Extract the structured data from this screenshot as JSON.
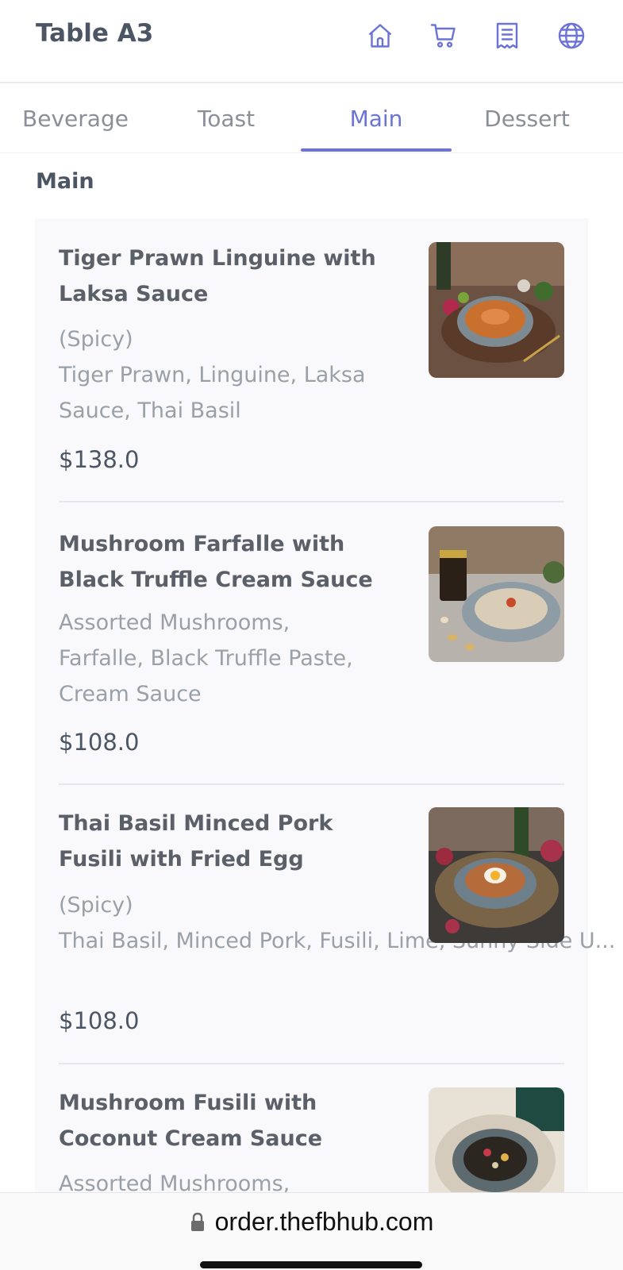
{
  "header": {
    "title": "Table A3",
    "icons": [
      "home-icon",
      "cart-icon",
      "receipt-icon",
      "globe-icon"
    ],
    "accent_color": "#6b73d8"
  },
  "tabs": [
    {
      "label": "Beverage",
      "active": false
    },
    {
      "label": "Toast",
      "active": false
    },
    {
      "label": "Main",
      "active": true
    },
    {
      "label": "Dessert",
      "active": false
    }
  ],
  "section": {
    "title": "Main"
  },
  "items": [
    {
      "name": "Tiger Prawn Linguine with Laksa Sauce",
      "note": "(Spicy)",
      "ingredients": "Tiger Prawn, Linguine, Laksa Sauce, Thai Basil",
      "price": "$138.0"
    },
    {
      "name": "Mushroom Farfalle with Black Truffle Cream Sauce",
      "note": "",
      "ingredients": "Assorted Mushrooms, Farfalle, Black Truffle Paste, Cream Sauce",
      "price": "$108.0"
    },
    {
      "name": "Thai Basil Minced Pork Fusili with Fried Egg",
      "note": "(Spicy)",
      "ingredients": "Thai Basil, Minced Pork, Fusili, Lime, Sunny Side U...",
      "price": "$108.0"
    },
    {
      "name": "Mushroom Fusili with Coconut Cream Sauce",
      "note": "",
      "ingredients": "Assorted Mushrooms,",
      "price": ""
    }
  ],
  "footer": {
    "url": "order.thefbhub.com"
  }
}
